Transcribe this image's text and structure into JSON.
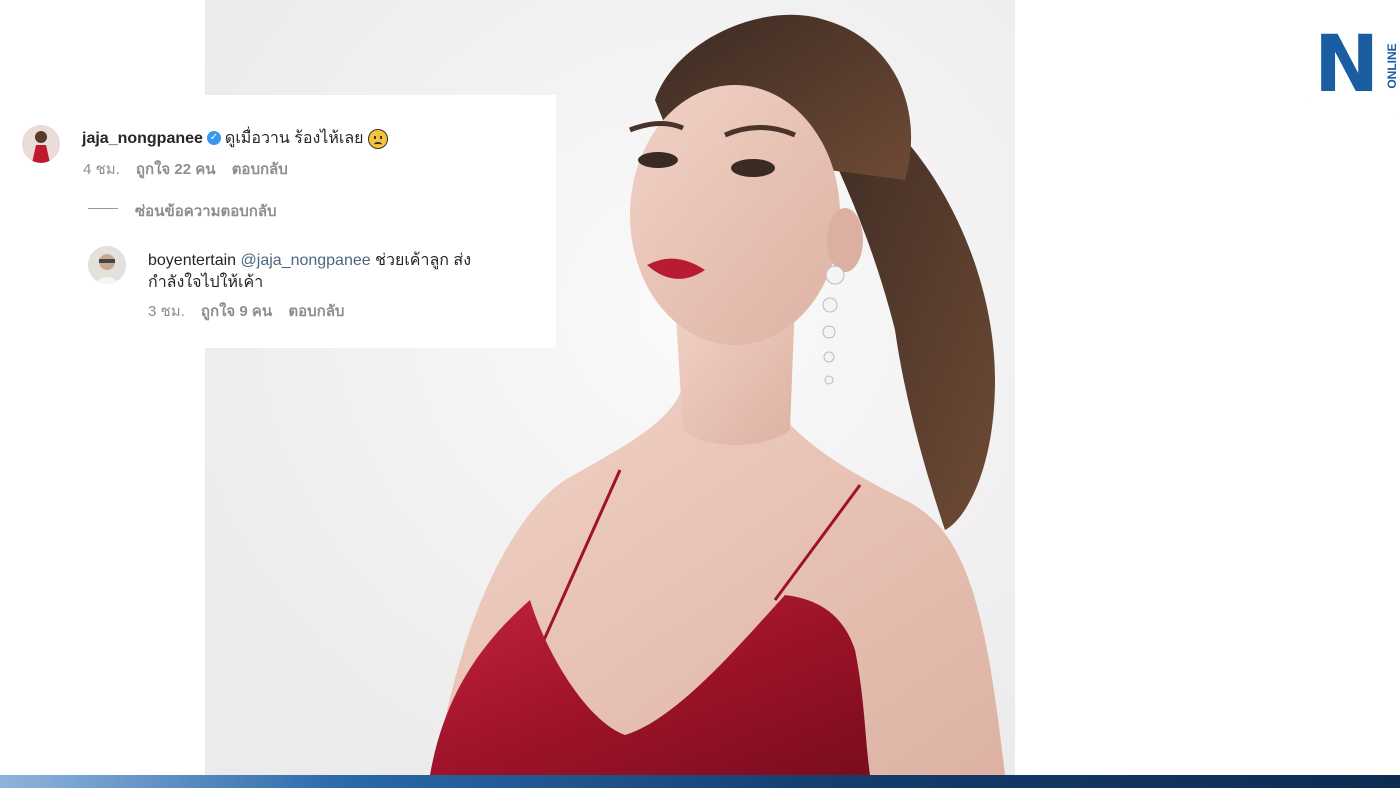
{
  "comment": {
    "username": "jaja_nongpanee",
    "verified": true,
    "text": "ดูเมื่อวาน ร้องไห้เลย",
    "emoji": "sad-face-emoji",
    "time": "4 ชม.",
    "likes": "ถูกใจ 22 คน",
    "reply_label": "ตอบกลับ"
  },
  "hide_replies_label": "ซ่อนข้อความตอบกลับ",
  "reply": {
    "username": "boyentertain",
    "mention": "@jaja_nongpanee",
    "text_line1": "ช่วยเค้าลูก ส่ง",
    "text_line2": "กำลังใจไปให้เค้า",
    "time": "3 ชม.",
    "likes": "ถูกใจ 9 คน",
    "reply_label": "ตอบกลับ"
  },
  "logo": {
    "letter": "N",
    "sub": "ONLINE",
    "color": "#1a5da0"
  },
  "colors": {
    "dress": "#a3142c",
    "mention": "#4b6584",
    "verified": "#3897f0"
  }
}
